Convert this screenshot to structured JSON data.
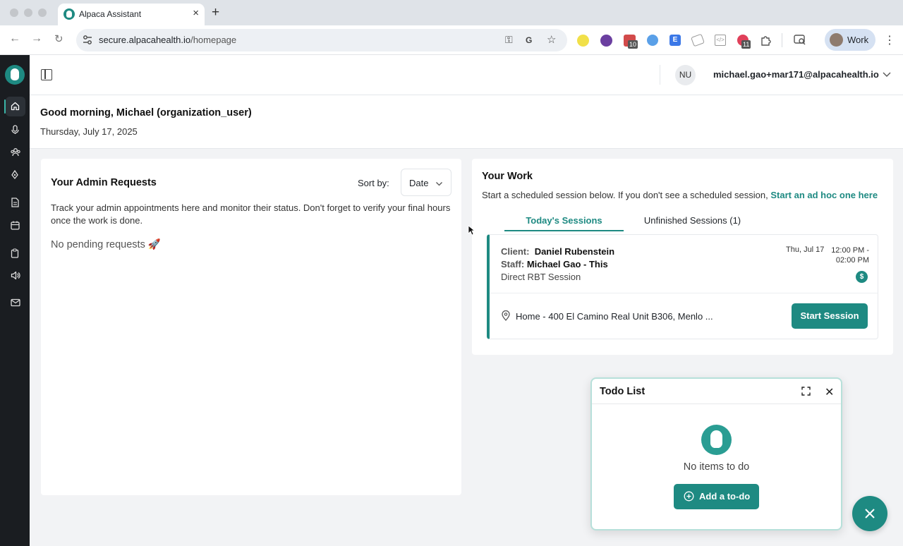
{
  "browser": {
    "tab_title": "Alpaca Assistant",
    "tab_close": "×",
    "new_tab": "+",
    "url_domain": "secure.alpacahealth.io",
    "url_path": "/homepage",
    "profile_label": "Work",
    "extension_badges": [
      "10",
      "11"
    ],
    "extension_icons": [
      "sun-extension-icon",
      "purple-extension-icon",
      "red-badge-extension-icon",
      "blue-extension-icon",
      "e-extension-icon",
      "grey-extension-icon",
      "code-extension-icon",
      "red-circle-extension-icon",
      "puzzle-icon"
    ]
  },
  "header": {
    "user_initials": "NU",
    "user_email": "michael.gao+mar171@alpacahealth.io"
  },
  "greeting": {
    "title": "Good morning, Michael (organization_user)",
    "date": "Thursday, July 17, 2025"
  },
  "admin": {
    "title": "Your Admin Requests",
    "sort_label": "Sort by:",
    "sort_value": "Date",
    "description": "Track your admin appointments here and monitor their status. Don't forget to verify your final hours once the work is done.",
    "empty": "No pending requests 🚀"
  },
  "work": {
    "title": "Your Work",
    "description": "Start a scheduled session below. If you don't see a scheduled session, ",
    "link": "Start an ad hoc one here",
    "tabs": [
      {
        "label": "Today's Sessions",
        "active": true
      },
      {
        "label": "Unfinished Sessions (1)",
        "active": false
      }
    ],
    "session": {
      "client_label": "Client:",
      "client": "Daniel Rubenstein",
      "staff_label": "Staff:",
      "staff": "Michael Gao - This",
      "type": "Direct RBT Session",
      "date": "Thu, Jul 17",
      "time": "12:00 PM - 02:00 PM",
      "billing_symbol": "$",
      "address": "Home - 400 El Camino Real Unit B306, Menlo ...",
      "start_button": "Start Session"
    }
  },
  "todo": {
    "title": "Todo List",
    "close": "✕",
    "empty": "No items to do",
    "add_button": "Add a to-do"
  },
  "colors": {
    "accent": "#1e8a82",
    "sidebar": "#1a1d21",
    "tab_active": "#1e8a82"
  }
}
